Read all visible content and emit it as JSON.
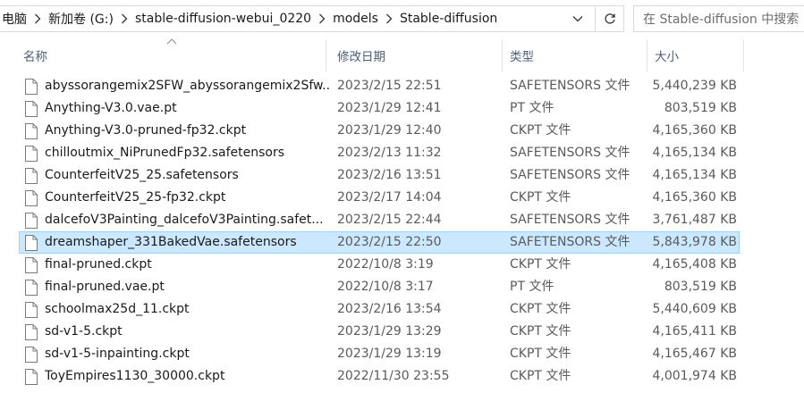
{
  "address_bar": {
    "breadcrumbs": [
      {
        "label": "电脑"
      },
      {
        "label": "新加卷 (G:)"
      },
      {
        "label": "stable-diffusion-webui_0220"
      },
      {
        "label": "models"
      },
      {
        "label": "Stable-diffusion"
      }
    ],
    "search_placeholder": "在 Stable-diffusion 中搜索"
  },
  "columns": {
    "name": "名称",
    "date": "修改日期",
    "type": "类型",
    "size": "大小"
  },
  "files": [
    {
      "name": "abyssorangemix2SFW_abyssorangemix2Sfw...",
      "date": "2023/2/15 22:51",
      "type": "SAFETENSORS 文件",
      "size": "5,440,239 KB"
    },
    {
      "name": "Anything-V3.0.vae.pt",
      "date": "2023/1/29 12:41",
      "type": "PT 文件",
      "size": "803,519 KB"
    },
    {
      "name": "Anything-V3.0-pruned-fp32.ckpt",
      "date": "2023/1/29 12:40",
      "type": "CKPT 文件",
      "size": "4,165,360 KB"
    },
    {
      "name": "chilloutmix_NiPrunedFp32.safetensors",
      "date": "2023/2/13 11:32",
      "type": "SAFETENSORS 文件",
      "size": "4,165,134 KB"
    },
    {
      "name": "CounterfeitV25_25.safetensors",
      "date": "2023/2/16 13:51",
      "type": "SAFETENSORS 文件",
      "size": "4,165,134 KB"
    },
    {
      "name": "CounterfeitV25_25-fp32.ckpt",
      "date": "2023/2/17 14:04",
      "type": "CKPT 文件",
      "size": "4,165,360 KB"
    },
    {
      "name": "dalcefoV3Painting_dalcefoV3Painting.safet...",
      "date": "2023/2/15 22:44",
      "type": "SAFETENSORS 文件",
      "size": "3,761,487 KB"
    },
    {
      "name": "dreamshaper_331BakedVae.safetensors",
      "date": "2023/2/15 22:50",
      "type": "SAFETENSORS 文件",
      "size": "5,843,978 KB",
      "selected": true
    },
    {
      "name": "final-pruned.ckpt",
      "date": "2022/10/8 3:19",
      "type": "CKPT 文件",
      "size": "4,165,408 KB"
    },
    {
      "name": "final-pruned.vae.pt",
      "date": "2022/10/8 3:17",
      "type": "PT 文件",
      "size": "803,519 KB"
    },
    {
      "name": "schoolmax25d_11.ckpt",
      "date": "2023/2/16 13:54",
      "type": "CKPT 文件",
      "size": "5,440,609 KB"
    },
    {
      "name": "sd-v1-5.ckpt",
      "date": "2023/1/29 13:29",
      "type": "CKPT 文件",
      "size": "4,165,411 KB"
    },
    {
      "name": "sd-v1-5-inpainting.ckpt",
      "date": "2023/1/29 13:19",
      "type": "CKPT 文件",
      "size": "4,165,467 KB"
    },
    {
      "name": "ToyEmpires1130_30000.ckpt",
      "date": "2022/11/30 23:55",
      "type": "CKPT 文件",
      "size": "4,001,974 KB"
    }
  ],
  "icons": {
    "breadcrumb_separator": "chevron-right-icon",
    "address_dropdown": "chevron-down-icon",
    "refresh": "refresh-icon",
    "file": "file-icon",
    "sort": "sort-ascending-icon"
  },
  "colors": {
    "selection_bg": "#cce8ff",
    "selection_border": "#99d1ff",
    "header_text": "#4c607a"
  }
}
